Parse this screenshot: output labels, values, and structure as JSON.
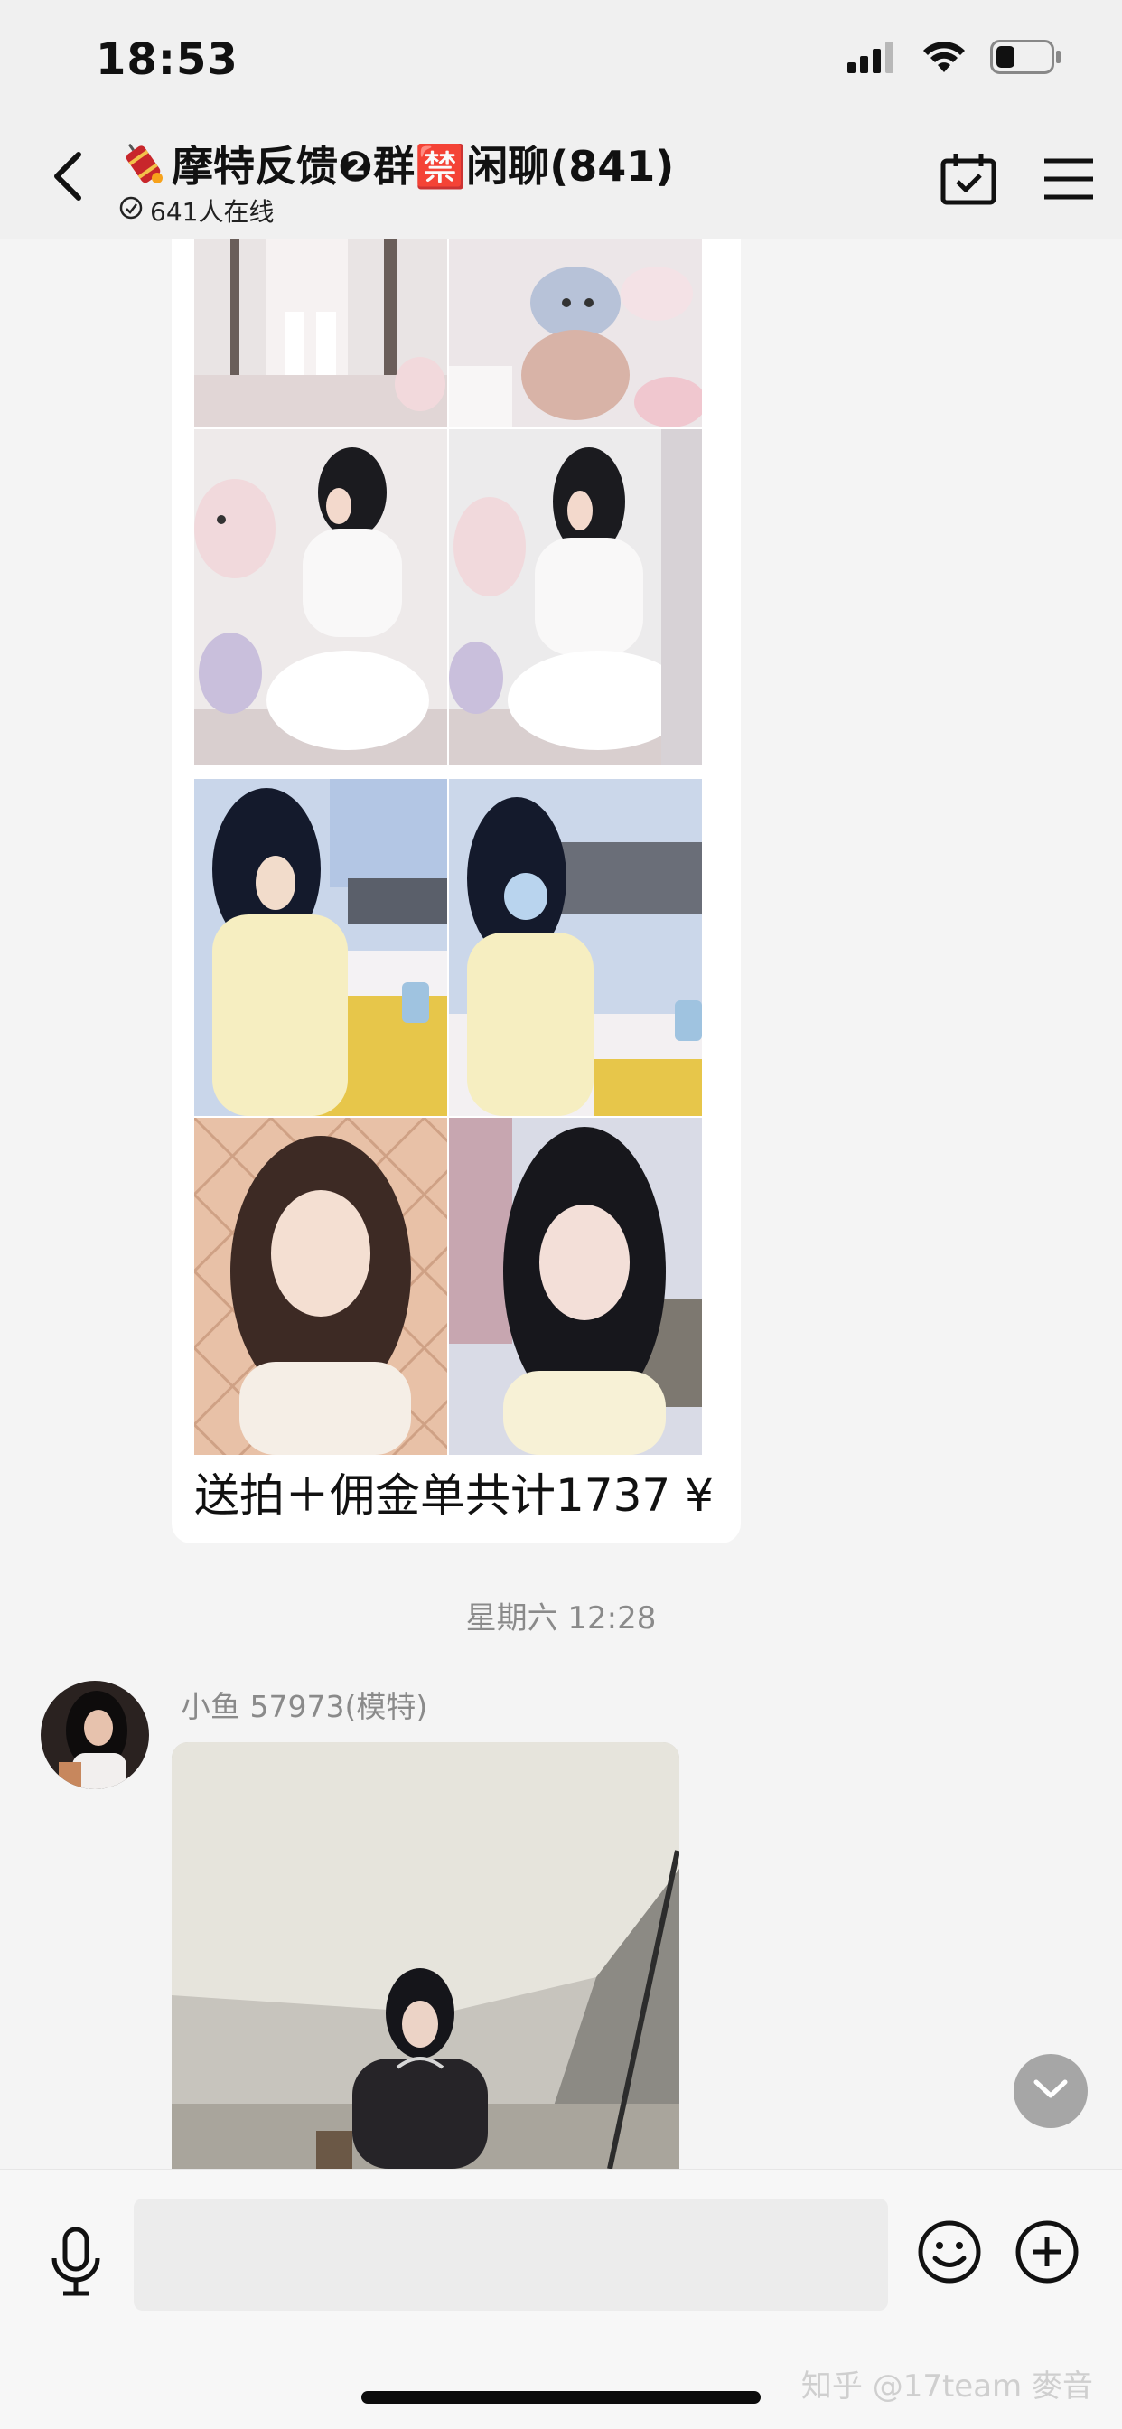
{
  "status_bar": {
    "time": "18:53",
    "icons": [
      "cellular-signal-icon",
      "wifi-icon",
      "battery-icon"
    ],
    "battery_level": 0.35
  },
  "header": {
    "title": "摩特反馈❷群🈲闲聊(841)",
    "title_icon": "firecracker-icon",
    "online_count": "641人在线",
    "actions": [
      "calendar-check-icon",
      "menu-icon"
    ]
  },
  "messages": [
    {
      "type": "image-grid",
      "caption": "送拍＋佣金单共计1737 ¥"
    },
    {
      "type": "timestamp",
      "text": "星期六 12:28"
    },
    {
      "type": "image",
      "sender": "小鱼 57973(模特)"
    }
  ],
  "input_bar": {
    "placeholder": "",
    "icons": [
      "microphone-icon",
      "emoji-icon",
      "plus-icon"
    ]
  },
  "watermark": "知乎 @17team 麥音",
  "colors": {
    "background": "#f4f4f4",
    "bubble": "#ffffff",
    "timestamp": "#8a8a8a"
  }
}
